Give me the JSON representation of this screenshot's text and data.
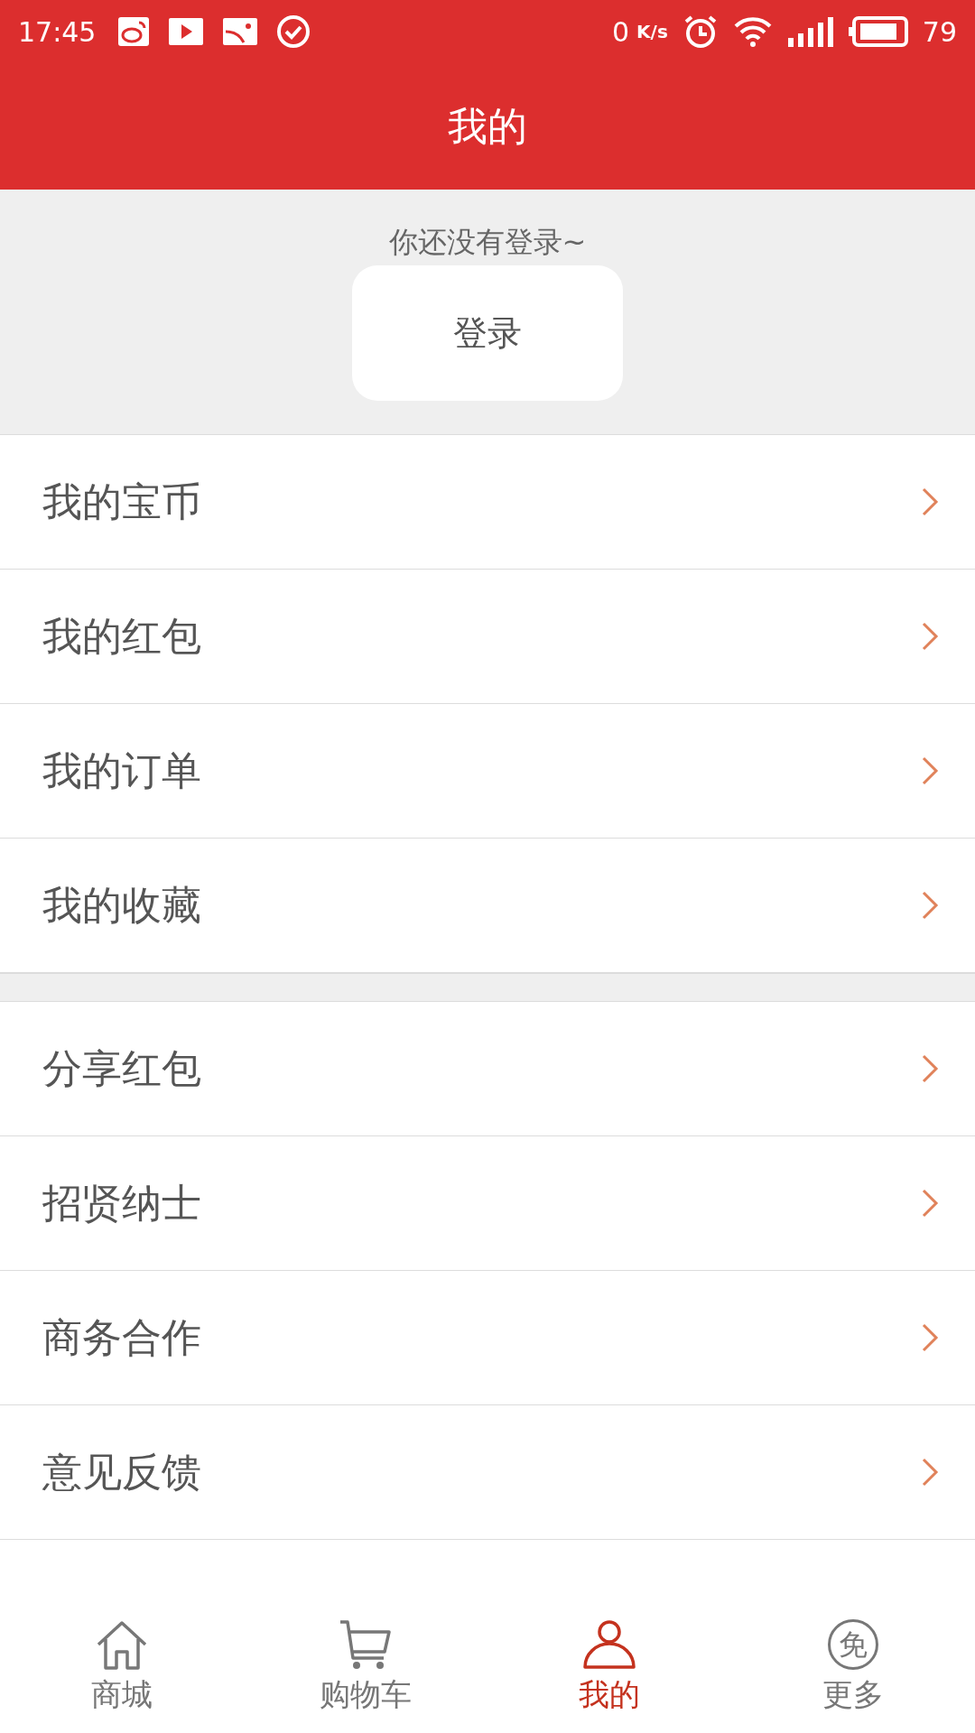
{
  "status_bar": {
    "time": "17:45",
    "net_speed": "0",
    "net_unit": "K/s",
    "battery": "79"
  },
  "title": "我的",
  "login": {
    "prompt": "你还没有登录~",
    "button": "登录"
  },
  "groups": [
    {
      "items": [
        {
          "label": "我的宝币"
        },
        {
          "label": "我的红包"
        },
        {
          "label": "我的订单"
        },
        {
          "label": "我的收藏"
        }
      ]
    },
    {
      "items": [
        {
          "label": "分享红包"
        },
        {
          "label": "招贤纳士"
        },
        {
          "label": "商务合作"
        },
        {
          "label": "意见反馈"
        }
      ]
    }
  ],
  "nav": [
    {
      "kind": "home",
      "label": "商城",
      "selected": false
    },
    {
      "kind": "cart",
      "label": "购物车",
      "selected": false
    },
    {
      "kind": "person",
      "label": "我的",
      "selected": true
    },
    {
      "kind": "badge",
      "label": "更多",
      "glyph": "免",
      "selected": false
    }
  ]
}
